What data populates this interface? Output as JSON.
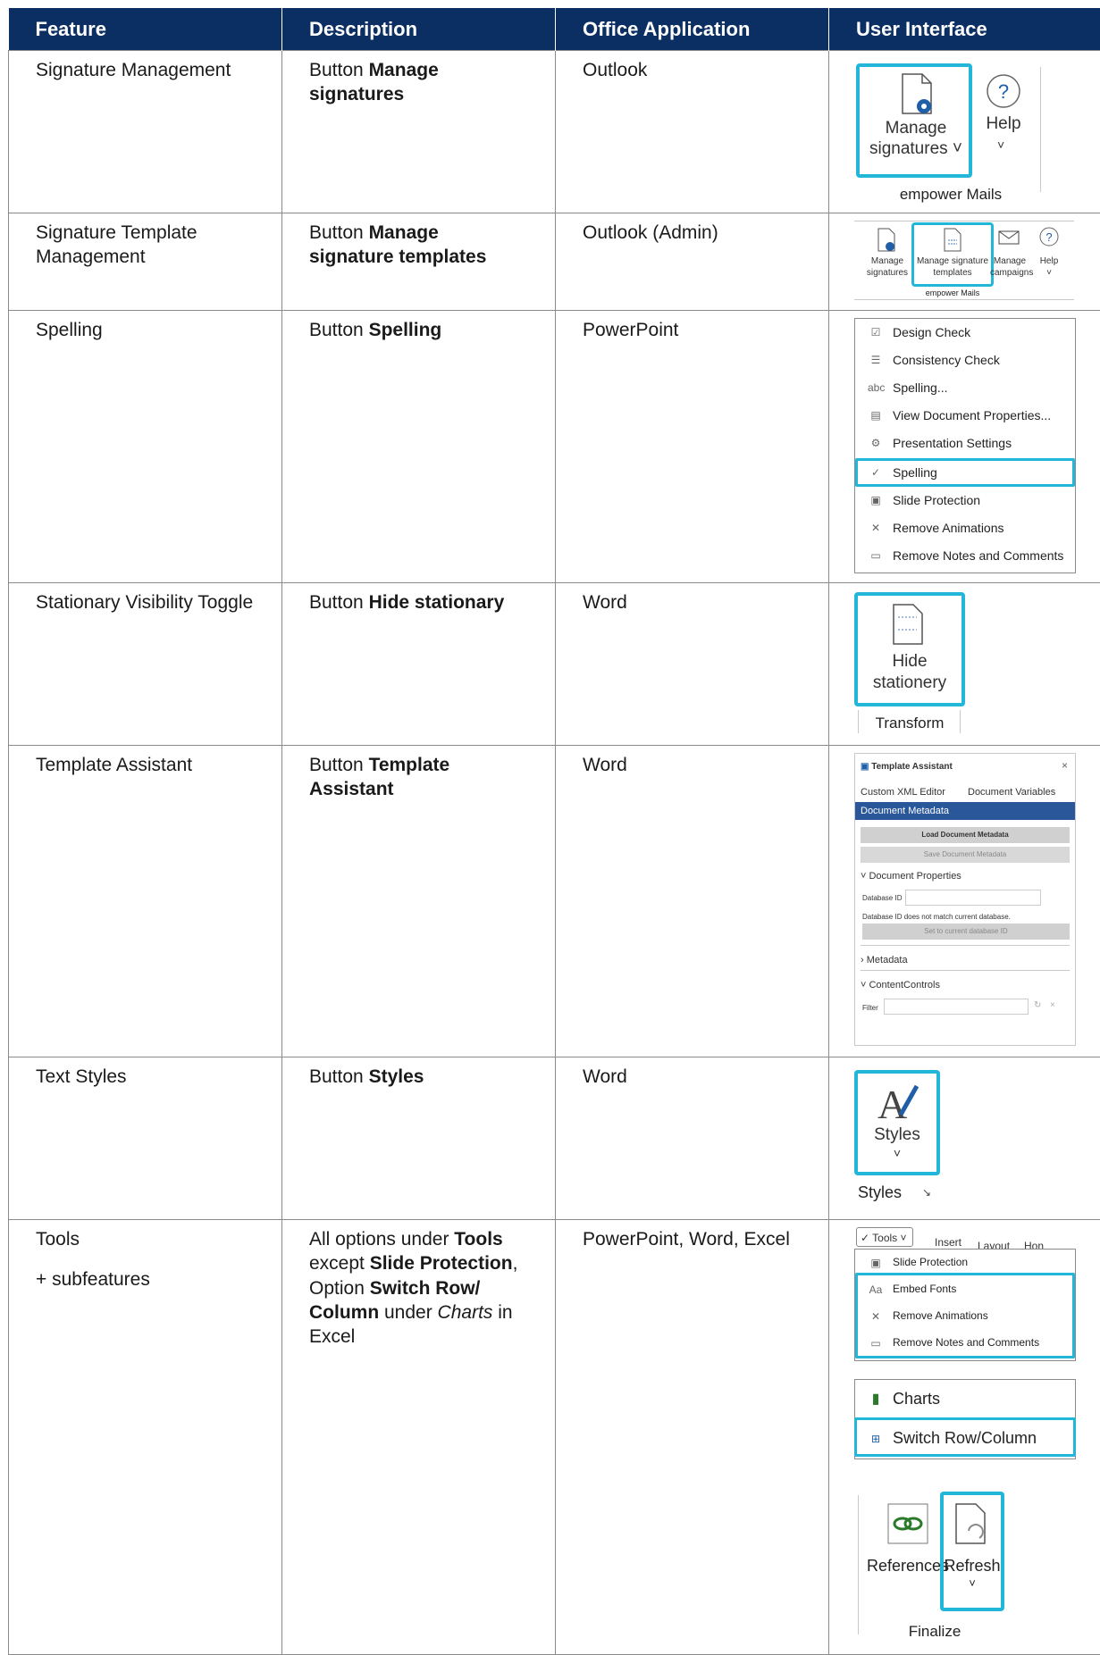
{
  "headers": {
    "feature": "Feature",
    "description": "Description",
    "app": "Office Application",
    "ui": "User Interface"
  },
  "rows": [
    {
      "feature": "Signature Management",
      "desc_pre": "Button ",
      "desc_bold": "Manage signatures",
      "desc_post": "",
      "app": "Outlook"
    },
    {
      "feature": "Signature Template Management",
      "desc_pre": "Button ",
      "desc_bold": "Manage signature templates",
      "desc_post": "",
      "app": "Outlook (Admin)"
    },
    {
      "feature": "Spelling",
      "desc_pre": "Button ",
      "desc_bold": "Spelling",
      "desc_post": "",
      "app": "PowerPoint"
    },
    {
      "feature": "Stationary Visibility Toggle",
      "desc_pre": "Button ",
      "desc_bold": "Hide stationary",
      "desc_post": "",
      "app": "Word"
    },
    {
      "feature": "Template Assistant",
      "desc_pre": "Button ",
      "desc_bold": "Template Assistant",
      "desc_post": "",
      "app": "Word"
    },
    {
      "feature": "Text Styles",
      "desc_pre": "Button ",
      "desc_bold": "Styles",
      "desc_post": "",
      "app": "Word"
    },
    {
      "feature": "Tools",
      "feature_sub": "+ subfeatures",
      "app": "PowerPoint, Word, Excel",
      "desc_parts": [
        "All options under ",
        "Tools",
        " except ",
        "Slide Protection",
        ", Option ",
        "Switch Row/ Column",
        " under ",
        "Charts",
        " in Excel"
      ]
    }
  ],
  "ui1": {
    "manage_l1": "Manage",
    "manage_l2": "signatures",
    "help": "Help",
    "group": "empower Mails"
  },
  "ui2": {
    "b1_l1": "Manage",
    "b1_l2": "signatures",
    "b2_l1": "Manage signature",
    "b2_l2": "templates",
    "b3_l1": "Manage",
    "b3_l2": "campaigns",
    "b4": "Help",
    "group": "empower Mails"
  },
  "ui3": {
    "items": [
      "Design Check",
      "Consistency Check",
      "Spelling...",
      "View Document Properties...",
      "Presentation Settings",
      "Spelling",
      "Slide Protection",
      "Remove Animations",
      "Remove Notes and Comments"
    ]
  },
  "ui4": {
    "l1": "Hide",
    "l2": "stationery",
    "group": "Transform"
  },
  "ui5": {
    "title": "Template Assistant",
    "tab1": "Custom XML Editor",
    "tab2": "Document Variables",
    "section": "Document Metadata",
    "load": "Load Document Metadata",
    "save": "Save Document Metadata",
    "props": "Document Properties",
    "dbid": "Database ID",
    "warn": "Database ID does not match current database.",
    "setbtn": "Set to current database ID",
    "meta": "Metadata",
    "cc": "ContentControls",
    "filter": "Filter"
  },
  "ui6": {
    "label": "Styles",
    "group": "Styles"
  },
  "ui7": {
    "tools": "Tools",
    "insert": "Insert",
    "layout": "Layout",
    "hon": "Hon",
    "items": [
      "Slide Protection",
      "Embed Fonts",
      "Remove Animations",
      "Remove Notes and Comments"
    ],
    "charts": "Charts",
    "switch": "Switch Row/Column",
    "refs": "References",
    "refresh": "Refresh",
    "group": "Finalize"
  }
}
